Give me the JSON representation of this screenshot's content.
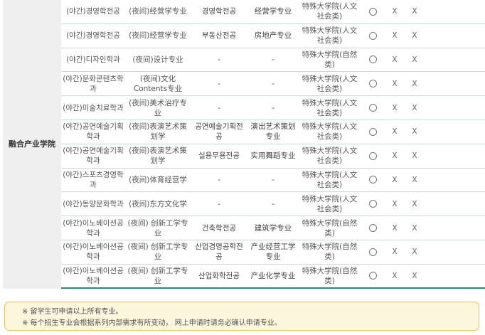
{
  "college": "融合产业学院",
  "mark_symbols": {
    "available": "○",
    "unavailable": "X"
  },
  "rows": [
    {
      "kor_dept": "(야간)경영학전공",
      "chn_dept": "(夜间)经营学专业",
      "kor_major": "경영학전공",
      "chn_major": "经营学专业",
      "grad_school": "特殊大学院(人文社会类)",
      "m1": "circle",
      "m2": "X",
      "m3": "X"
    },
    {
      "kor_dept": "(야간)경영학전공",
      "chn_dept": "(夜间)经营学专业",
      "kor_major": "부동산전공",
      "chn_major": "房地产专业",
      "grad_school": "特殊大学院(人文社会类)",
      "m1": "circle",
      "m2": "X",
      "m3": "X"
    },
    {
      "kor_dept": "(야간)디자인학과",
      "chn_dept": "(夜间)设计专业",
      "kor_major": "-",
      "chn_major": "-",
      "grad_school": "特殊大学院(自然类)",
      "m1": "circle",
      "m2": "X",
      "m3": "X"
    },
    {
      "kor_dept": "(야간)문화콘텐츠학과",
      "chn_dept": "(夜间)文化Contents专业",
      "kor_major": "-",
      "chn_major": "-",
      "grad_school": "特殊大学院(人文社会类)",
      "m1": "circle",
      "m2": "X",
      "m3": "X"
    },
    {
      "kor_dept": "(야간)미술치료학과",
      "chn_dept": "(夜间)美术治疗专业",
      "kor_major": "-",
      "chn_major": "-",
      "grad_school": "特殊大学院(人文社会类)",
      "m1": "circle",
      "m2": "X",
      "m3": "X"
    },
    {
      "kor_dept": "(야간)공연예술기획학과",
      "chn_dept": "(夜间)表演艺术策划学",
      "kor_major": "공연예술기획전공",
      "chn_major": "演出艺术策划专业",
      "grad_school": "特殊大学院(人文社会类)",
      "m1": "circle",
      "m2": "X",
      "m3": "X"
    },
    {
      "kor_dept": "(야간)공연예술기획학과",
      "chn_dept": "(夜间)表演艺术策划学",
      "kor_major": "실용무용전공",
      "chn_major": "实用舞蹈专业",
      "grad_school": "特殊大学院(人文社会类)",
      "m1": "circle",
      "m2": "X",
      "m3": "X"
    },
    {
      "kor_dept": "(야간)스포츠경영학과",
      "chn_dept": "(夜间)体育经营学",
      "kor_major": "-",
      "chn_major": "-",
      "grad_school": "特殊大学院(人文社会类)",
      "m1": "circle",
      "m2": "X",
      "m3": "X"
    },
    {
      "kor_dept": "(야간)동양문화학과",
      "chn_dept": "(夜间)东方文化学",
      "kor_major": "-",
      "chn_major": "-",
      "grad_school": "特殊大学院(人文社会类)",
      "m1": "circle",
      "m2": "X",
      "m3": "X"
    },
    {
      "kor_dept": "(야간)이노베이션공학과",
      "chn_dept": "(夜间) 创新工学专业",
      "kor_major": "건축학전공",
      "chn_major": "建筑学专业",
      "grad_school": "特殊大学院(自然类)",
      "m1": "circle",
      "m2": "X",
      "m3": "X"
    },
    {
      "kor_dept": "(야간)이노베이션공학과",
      "chn_dept": "(夜间) 创新工学专业",
      "kor_major": "산업경영공학전공",
      "chn_major": "产业经营工学专业",
      "grad_school": "特殊大学院(自然类)",
      "m1": "circle",
      "m2": "X",
      "m3": "X"
    },
    {
      "kor_dept": "(야간)이노베이션공학과",
      "chn_dept": "(夜间) 创新工学专业",
      "kor_major": "산업화학전공",
      "chn_major": "产业化学专业",
      "grad_school": "特殊大学院(自然类)",
      "m1": "circle",
      "m2": "X",
      "m3": "X"
    }
  ],
  "notes": [
    "※ 留学生可申请以上所有专业。",
    "※ 每个招生专业会根据系列内部需求有所变动， 网上申请时请务必确认申请专业。"
  ],
  "colors": {
    "row_border": "#c4dfd6",
    "bottom_border": "#2e8b6a",
    "college_bg": "#efefef",
    "note_bg": "#fcf7dc",
    "note_border": "#e2c25c"
  }
}
